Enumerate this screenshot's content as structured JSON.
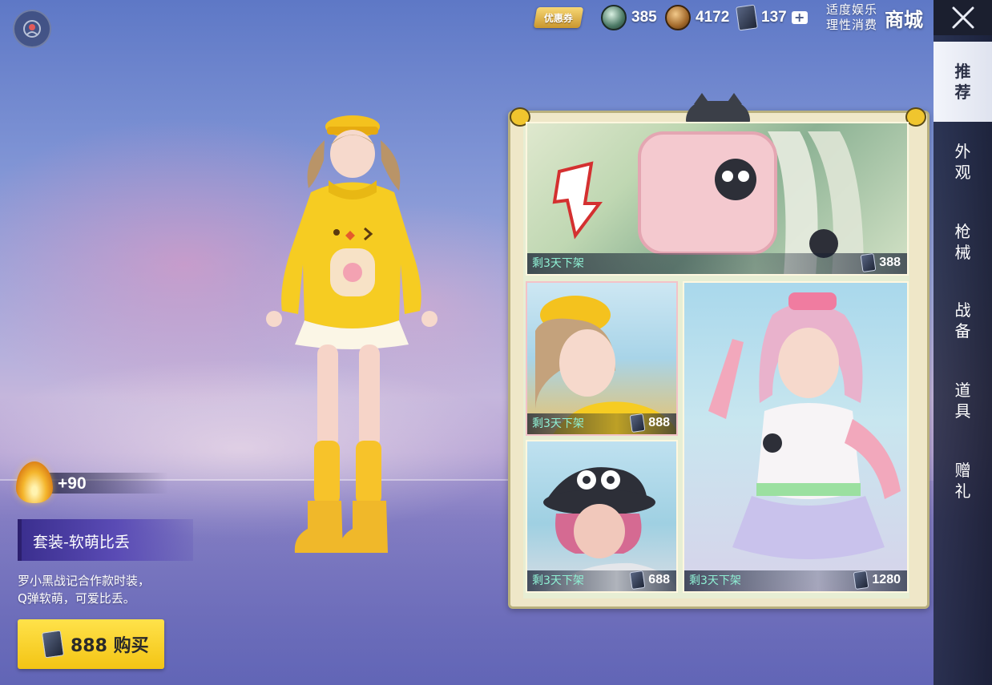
{
  "top_bar": {
    "coupon_label": "优惠券",
    "currencies": [
      {
        "name": "green-coin",
        "value": "385"
      },
      {
        "name": "bronze-coin",
        "value": "4172"
      },
      {
        "name": "card-ticket",
        "value": "137"
      }
    ],
    "notice_line1": "适度娱乐",
    "notice_line2": "理性消费",
    "shop_title": "商城"
  },
  "tabs": [
    {
      "label": "推荐",
      "active": true
    },
    {
      "label": "外观",
      "active": false
    },
    {
      "label": "枪械",
      "active": false
    },
    {
      "label": "战备",
      "active": false
    },
    {
      "label": "道具",
      "active": false
    },
    {
      "label": "赠礼",
      "active": false
    }
  ],
  "item": {
    "score": "+90",
    "set_name": "套装-软萌比丢",
    "desc_line1": "罗小黑战记合作款时装，",
    "desc_line2": "Q弹软萌，可爱比丢。",
    "buy_price": "888",
    "buy_label": "购买"
  },
  "showcase": {
    "tiles": [
      {
        "timer": "剩3天下架",
        "price": "388"
      },
      {
        "timer": "剩3天下架",
        "price": "888"
      },
      {
        "timer": "剩3天下架",
        "price": "688"
      },
      {
        "timer": "剩3天下架",
        "price": "1280"
      }
    ]
  },
  "colors": {
    "accent_yellow": "#f3c414",
    "timer_text": "#8ff0d4",
    "set_name_bg": "#5a4bb5"
  }
}
